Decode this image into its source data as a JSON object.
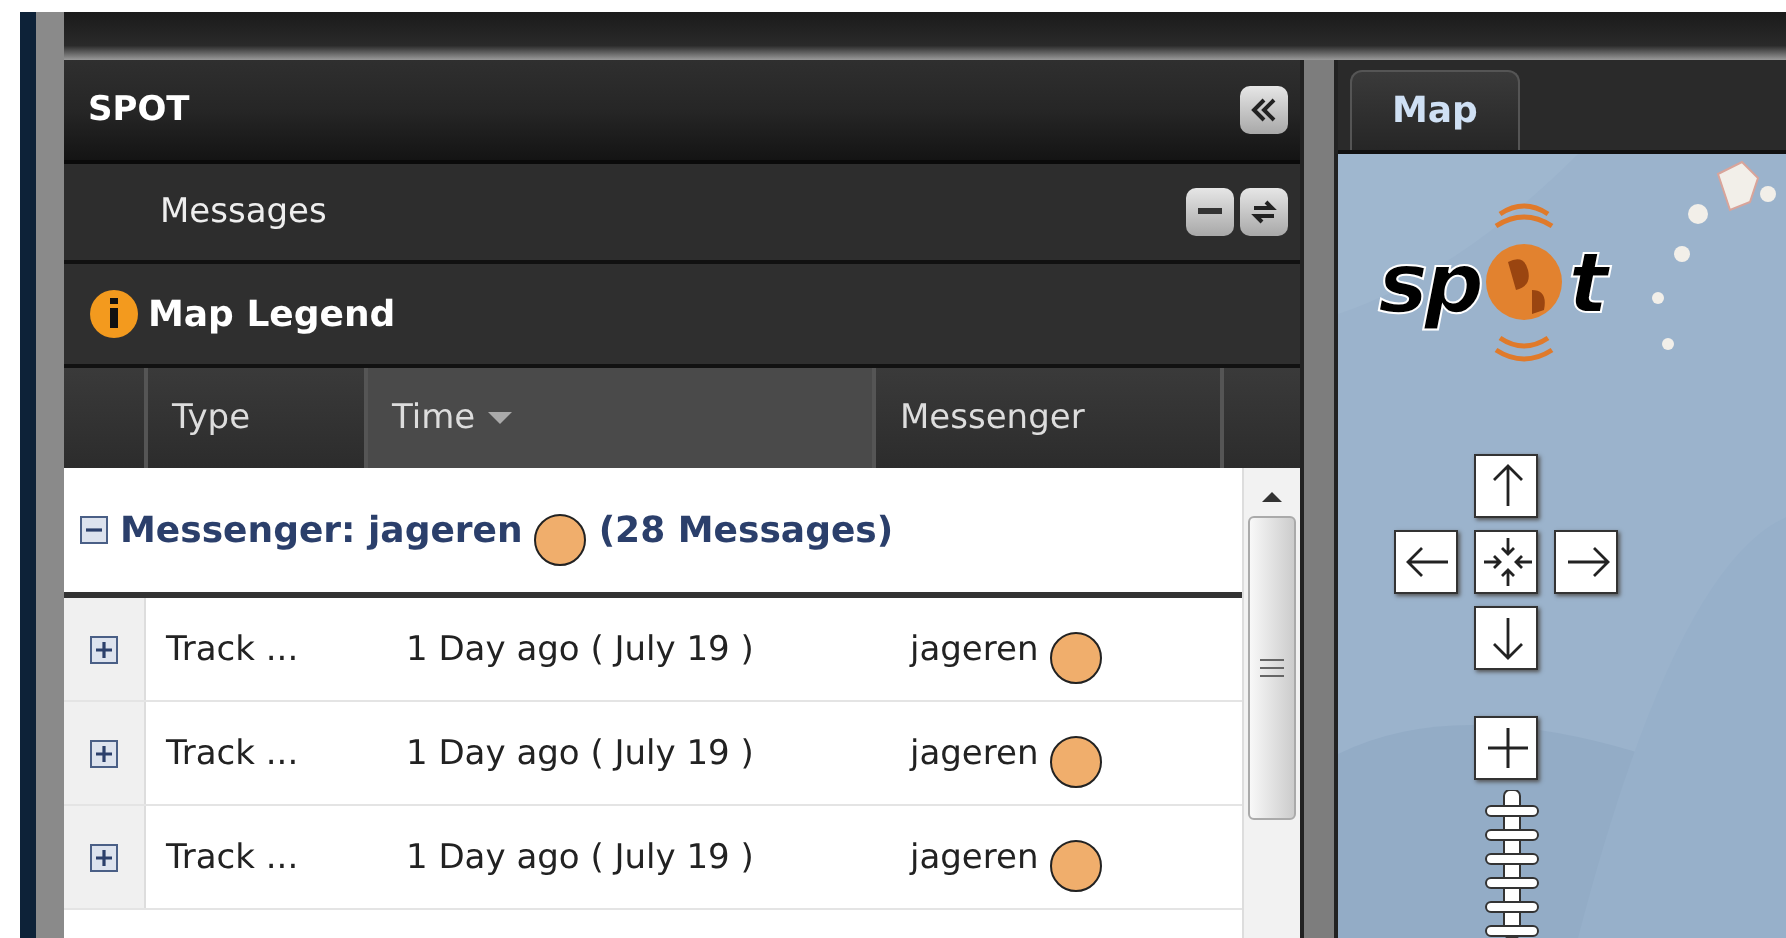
{
  "panel": {
    "title": "SPOT",
    "section": "Messages",
    "legend": "Map Legend"
  },
  "columns": [
    {
      "label": "Type",
      "sorted": false
    },
    {
      "label": "Time",
      "sorted": true
    },
    {
      "label": "Messenger",
      "sorted": false
    }
  ],
  "group": {
    "label": "Messenger: jageren",
    "count": "(28 Messages)",
    "expanded": true,
    "color": "#f0ae6c"
  },
  "rows": [
    {
      "type": "Track ...",
      "time": "1 Day ago ( July 19 )",
      "messenger": "jageren",
      "color": "#f0ae6c",
      "expanded": false
    },
    {
      "type": "Track ...",
      "time": "1 Day ago ( July 19 )",
      "messenger": "jageren",
      "color": "#f0ae6c",
      "expanded": false
    },
    {
      "type": "Track ...",
      "time": "1 Day ago ( July 19 )",
      "messenger": "jageren",
      "color": "#f0ae6c",
      "expanded": false
    }
  ],
  "map": {
    "tab": {
      "label": "Map",
      "selected": true
    },
    "logo": [
      "sp",
      "t"
    ]
  }
}
